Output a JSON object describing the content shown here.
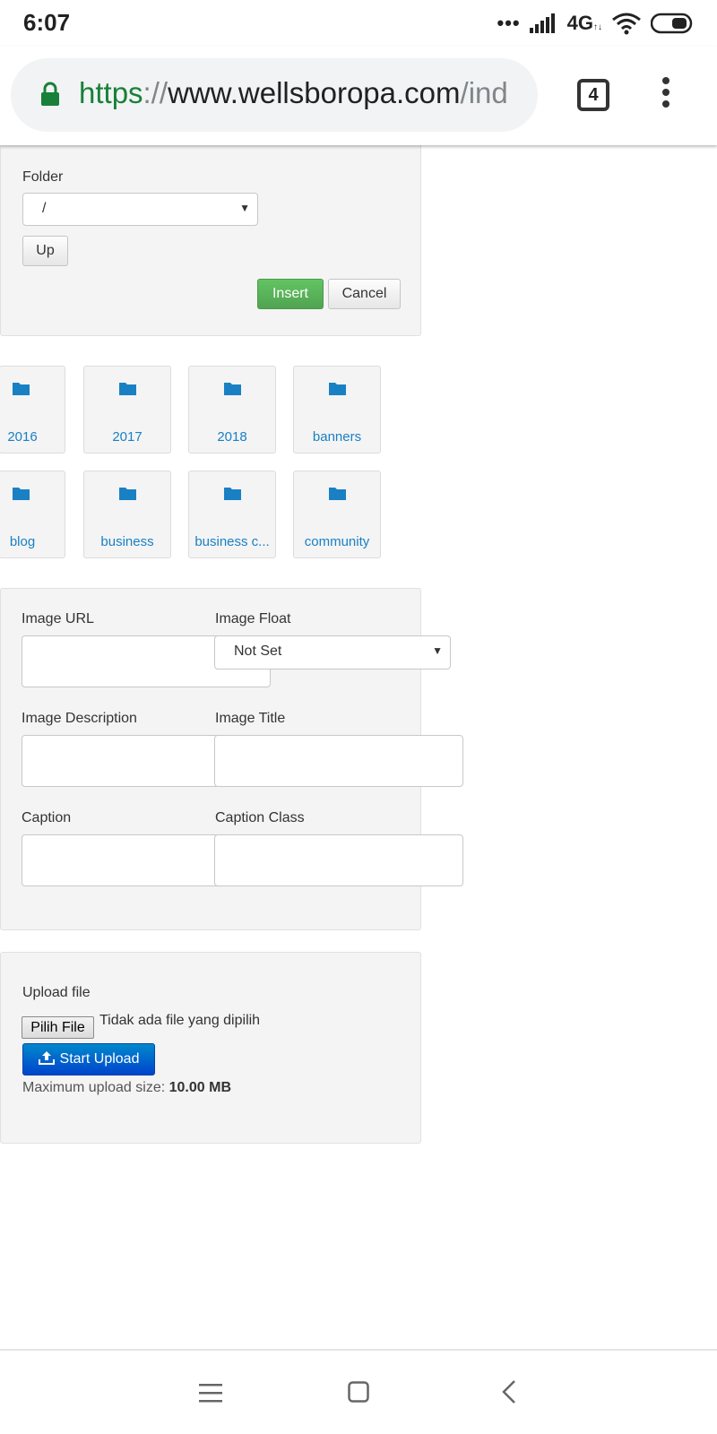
{
  "status_bar": {
    "time": "6:07",
    "dots": "•••",
    "network": "4G"
  },
  "browser": {
    "url_scheme": "https",
    "url_sep": "://",
    "url_host": "www.wellsboropa.com",
    "url_path": "/ind",
    "tab_count": "4"
  },
  "folder_panel": {
    "folder_label": "Folder",
    "folder_value": "/",
    "up_label": "Up",
    "insert_label": "Insert",
    "cancel_label": "Cancel"
  },
  "folders": [
    "2016",
    "2017",
    "2018",
    "banners",
    "blog",
    "business",
    "business c...",
    "community"
  ],
  "image_panel": {
    "image_url_label": "Image URL",
    "image_float_label": "Image Float",
    "image_float_value": "Not Set",
    "image_description_label": "Image Description",
    "image_title_label": "Image Title",
    "caption_label": "Caption",
    "caption_class_label": "Caption Class",
    "image_url_value": "",
    "image_description_value": "",
    "image_title_value": "",
    "caption_value": "",
    "caption_class_value": ""
  },
  "upload_panel": {
    "upload_label": "Upload file",
    "choose_file_label": "Pilih File",
    "no_file_text": "Tidak ada file yang dipilih",
    "start_upload_label": "Start Upload",
    "max_size_label": "Maximum upload size:",
    "max_size_value": "10.00 MB"
  },
  "colors": {
    "accent_green": "#5cb85c",
    "accent_blue": "#0055cc",
    "folder_blue": "#1a80c4",
    "secure_green": "#188038"
  }
}
